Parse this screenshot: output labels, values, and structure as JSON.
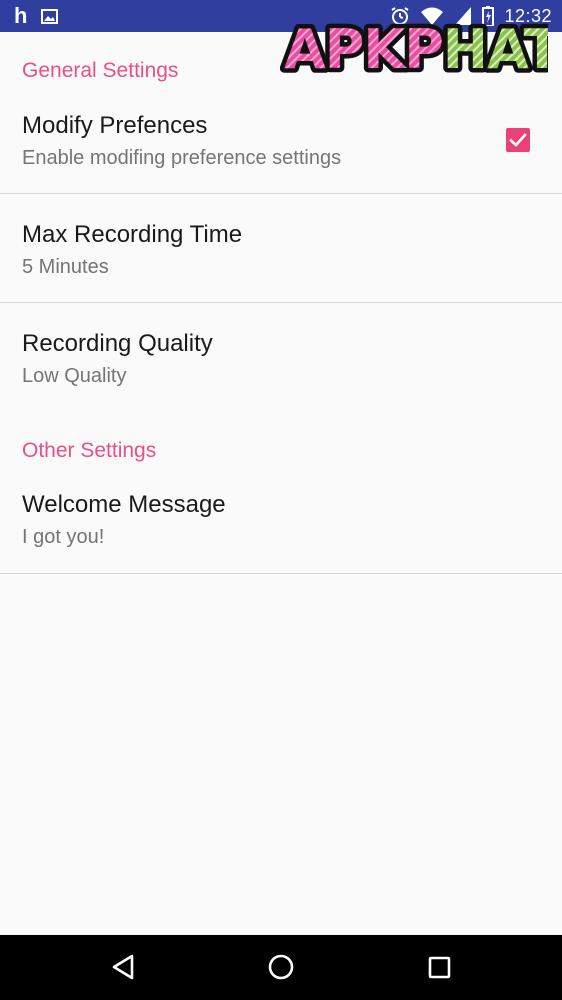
{
  "status_bar": {
    "time": "12:32",
    "notification_icons": [
      "h-app-icon",
      "image-icon"
    ],
    "system_icons": [
      "alarm-icon",
      "wifi-icon",
      "signal-icon",
      "battery-icon"
    ]
  },
  "watermark": {
    "text": "APKPHAT"
  },
  "categories": {
    "general": "General Settings",
    "other": "Other Settings"
  },
  "prefs": {
    "modify": {
      "title": "Modify Prefences",
      "summary": "Enable modifing preference settings",
      "checked": true
    },
    "max_time": {
      "title": "Max Recording Time",
      "summary": "5 Minutes"
    },
    "quality": {
      "title": "Recording Quality",
      "summary": "Low Quality"
    },
    "welcome": {
      "title": "Welcome Message",
      "summary": "I got you!"
    }
  },
  "nav_bar": {
    "buttons": [
      "back-icon",
      "home-icon",
      "recents-icon"
    ]
  },
  "colors": {
    "status_bar": "#303f9f",
    "accent": "#ec407a",
    "category_text": "#e84f8c",
    "background": "#fafafa",
    "nav_bar": "#000000"
  }
}
